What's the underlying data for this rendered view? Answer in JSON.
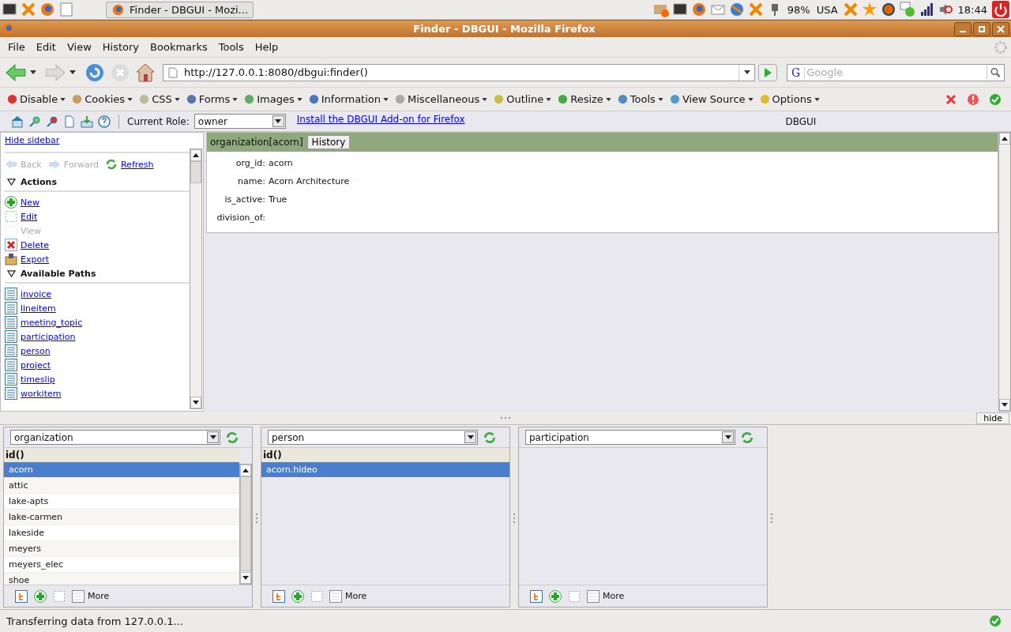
{
  "taskbar": {
    "task": "Finder - DBGUI - Mozi...",
    "battery": "98%",
    "keyboard": "USA",
    "clock": "18:44"
  },
  "window": {
    "title": "Finder - DBGUI - Mozilla Firefox"
  },
  "menu": [
    "File",
    "Edit",
    "View",
    "History",
    "Bookmarks",
    "Tools",
    "Help"
  ],
  "address": {
    "url": "http://127.0.0.1:8080/dbgui:finder()",
    "engine_logo": "G",
    "search_placeholder": "Google"
  },
  "webdev_toolbar": [
    {
      "label": "Disable",
      "kind": "disable"
    },
    {
      "label": "Cookies",
      "kind": "cookies"
    },
    {
      "label": "CSS",
      "kind": "css"
    },
    {
      "label": "Forms",
      "kind": "forms"
    },
    {
      "label": "Images",
      "kind": "images"
    },
    {
      "label": "Information",
      "kind": "information"
    },
    {
      "label": "Miscellaneous",
      "kind": "misc"
    },
    {
      "label": "Outline",
      "kind": "outline"
    },
    {
      "label": "Resize",
      "kind": "resize"
    },
    {
      "label": "Tools",
      "kind": "tools"
    },
    {
      "label": "View Source",
      "kind": "source"
    },
    {
      "label": "Options",
      "kind": "options"
    }
  ],
  "dbgui_bar": {
    "role_label": "Current Role:",
    "role": "owner",
    "addon_link": "Install the DBGUI Add-on for Firefox",
    "title": "DBGUI"
  },
  "sidebar": {
    "hide_link": "Hide sidebar",
    "nav": [
      {
        "label": "Back",
        "kind": "back",
        "disabled": true
      },
      {
        "label": "Forward",
        "kind": "forward",
        "disabled": true
      },
      {
        "label": "Refresh",
        "kind": "refresh",
        "disabled": false
      }
    ],
    "sections": [
      {
        "title": "Actions",
        "expanded": true,
        "items": [
          {
            "label": "New",
            "kind": "new",
            "disabled": false
          },
          {
            "label": "Edit",
            "kind": "edit",
            "disabled": false
          },
          {
            "label": "View",
            "kind": "edit",
            "disabled": true
          },
          {
            "label": "Delete",
            "kind": "delete",
            "disabled": false
          },
          {
            "label": "Export",
            "kind": "export",
            "disabled": false
          }
        ]
      },
      {
        "title": "Available Paths",
        "expanded": true,
        "items": [
          {
            "label": "invoice",
            "kind": "path",
            "disabled": false
          },
          {
            "label": "lineitem",
            "kind": "path",
            "disabled": false
          },
          {
            "label": "meeting_topic",
            "kind": "path",
            "disabled": false
          },
          {
            "label": "participation",
            "kind": "path",
            "disabled": false
          },
          {
            "label": "person",
            "kind": "path",
            "disabled": false
          },
          {
            "label": "project",
            "kind": "path",
            "disabled": false
          },
          {
            "label": "timeslip",
            "kind": "path",
            "disabled": false
          },
          {
            "label": "workitem",
            "kind": "path",
            "disabled": false
          }
        ]
      }
    ]
  },
  "detail": {
    "title": "organization[acorn]",
    "history_button": "History",
    "fields": [
      {
        "label": "org_id:",
        "value": "acorn"
      },
      {
        "label": "name:",
        "value": "Acorn Architecture"
      },
      {
        "label": "is_active:",
        "value": "True"
      },
      {
        "label": "division_of:"
      }
    ]
  },
  "hide_button": "hide",
  "panes": [
    {
      "type": "organization",
      "column": "id()",
      "more": "More",
      "rows": [
        {
          "id": "acorn",
          "selected": true
        },
        {
          "id": "attic",
          "selected": false
        },
        {
          "id": "lake-apts",
          "selected": false
        },
        {
          "id": "lake-carmen",
          "selected": false
        },
        {
          "id": "lakeside",
          "selected": false
        },
        {
          "id": "meyers",
          "selected": false
        },
        {
          "id": "meyers_elec",
          "selected": false
        },
        {
          "id": "shoe",
          "selected": false
        }
      ]
    },
    {
      "type": "person",
      "column": "id()",
      "more": "More",
      "rows": [
        {
          "id": "acorn.hideo",
          "selected": true
        }
      ]
    },
    {
      "type": "participation",
      "more": "More"
    }
  ],
  "status_bar": "Transferring data from 127.0.0.1..."
}
